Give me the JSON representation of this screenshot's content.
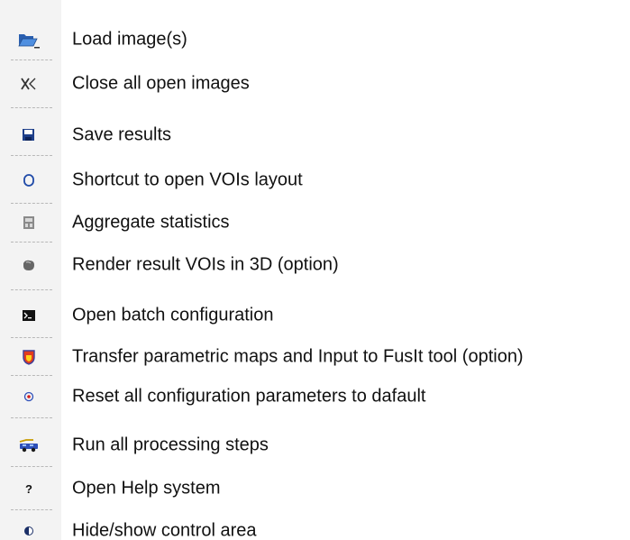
{
  "menu": {
    "items": [
      {
        "label": "Load image(s)",
        "icon": "folder-open-icon"
      },
      {
        "label": "Close all open images",
        "icon": "close-all-icon"
      },
      {
        "label": "Save results",
        "icon": "floppy-disk-icon"
      },
      {
        "label": "Shortcut to open VOIs layout",
        "icon": "voi-outline-icon"
      },
      {
        "label": "Aggregate statistics",
        "icon": "aggregate-stats-icon"
      },
      {
        "label": "Render result VOIs in 3D (option)",
        "icon": "3d-render-icon"
      },
      {
        "label": "Open batch configuration",
        "icon": "terminal-icon"
      },
      {
        "label": "Transfer parametric maps and Input to FusIt tool (option)",
        "icon": "fusit-transfer-icon"
      },
      {
        "label": "Reset all configuration parameters to dafault",
        "icon": "reset-target-icon"
      },
      {
        "label": "Run all processing steps",
        "icon": "run-vehicle-icon"
      },
      {
        "label": "Open Help system",
        "icon": "help-icon"
      },
      {
        "label": "Hide/show control area",
        "icon": "toggle-control-area-icon"
      }
    ]
  }
}
